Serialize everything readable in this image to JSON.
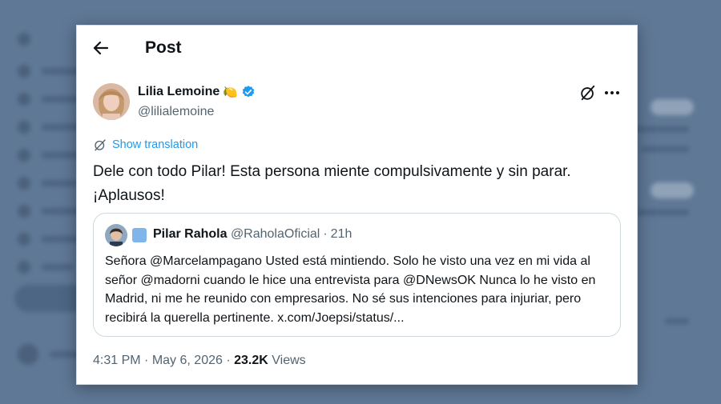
{
  "header": {
    "title": "Post"
  },
  "post": {
    "author_name": "Lilia Lemoine",
    "author_emoji": "🍋",
    "author_handle": "@lilialemoine",
    "translate_label": "Show translation",
    "text": "Dele con todo Pilar! Esta persona miente compulsivamente y sin parar.\n¡Aplausos!",
    "time": "4:31 PM",
    "separator": "·",
    "date": "May 6, 2026",
    "views_count": "23.2K",
    "views_label": "Views"
  },
  "quote": {
    "author_name": "Pilar Rahola",
    "author_handle": "@RaholaOficial",
    "separator": "·",
    "time_ago": "21h",
    "text": "Señora @Marcelampagano Usted está mintiendo. Solo he visto una vez en mi vida al señor @madorni cuando le hice una entrevista para @DNewsOK Nunca lo he visto en Madrid, ni me he reunido con empresarios. No sé sus intenciones para injuriar, pero recibirá la querella pertinente. x.com/Joepsi/status/..."
  },
  "icons": {
    "back": "arrow-left-icon",
    "verified": "verified-badge-icon",
    "grok": "grok-icon",
    "more": "more-horizontal-icon",
    "translate": "translate-icon"
  },
  "colors": {
    "accent": "#1d9bf0",
    "text": "#0f1419",
    "muted": "#536471",
    "backdrop": "#5f7896"
  }
}
